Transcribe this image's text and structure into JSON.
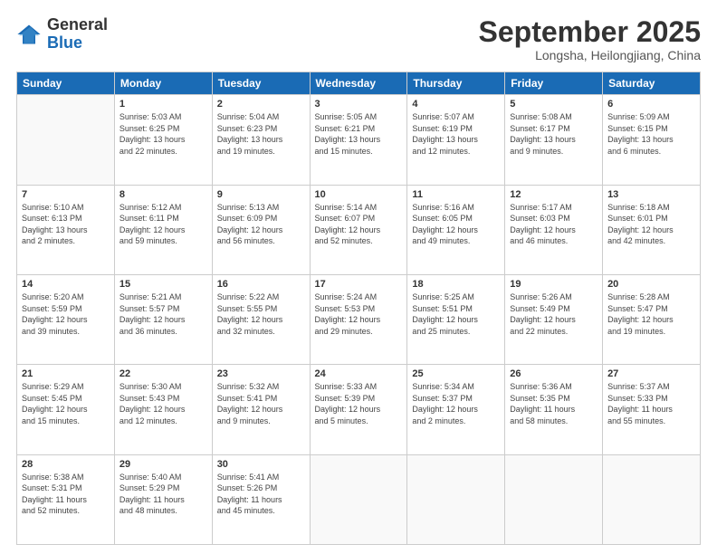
{
  "logo": {
    "general": "General",
    "blue": "Blue"
  },
  "title": "September 2025",
  "location": "Longsha, Heilongjiang, China",
  "days_of_week": [
    "Sunday",
    "Monday",
    "Tuesday",
    "Wednesday",
    "Thursday",
    "Friday",
    "Saturday"
  ],
  "weeks": [
    [
      {
        "day": "",
        "info": ""
      },
      {
        "day": "1",
        "info": "Sunrise: 5:03 AM\nSunset: 6:25 PM\nDaylight: 13 hours\nand 22 minutes."
      },
      {
        "day": "2",
        "info": "Sunrise: 5:04 AM\nSunset: 6:23 PM\nDaylight: 13 hours\nand 19 minutes."
      },
      {
        "day": "3",
        "info": "Sunrise: 5:05 AM\nSunset: 6:21 PM\nDaylight: 13 hours\nand 15 minutes."
      },
      {
        "day": "4",
        "info": "Sunrise: 5:07 AM\nSunset: 6:19 PM\nDaylight: 13 hours\nand 12 minutes."
      },
      {
        "day": "5",
        "info": "Sunrise: 5:08 AM\nSunset: 6:17 PM\nDaylight: 13 hours\nand 9 minutes."
      },
      {
        "day": "6",
        "info": "Sunrise: 5:09 AM\nSunset: 6:15 PM\nDaylight: 13 hours\nand 6 minutes."
      }
    ],
    [
      {
        "day": "7",
        "info": "Sunrise: 5:10 AM\nSunset: 6:13 PM\nDaylight: 13 hours\nand 2 minutes."
      },
      {
        "day": "8",
        "info": "Sunrise: 5:12 AM\nSunset: 6:11 PM\nDaylight: 12 hours\nand 59 minutes."
      },
      {
        "day": "9",
        "info": "Sunrise: 5:13 AM\nSunset: 6:09 PM\nDaylight: 12 hours\nand 56 minutes."
      },
      {
        "day": "10",
        "info": "Sunrise: 5:14 AM\nSunset: 6:07 PM\nDaylight: 12 hours\nand 52 minutes."
      },
      {
        "day": "11",
        "info": "Sunrise: 5:16 AM\nSunset: 6:05 PM\nDaylight: 12 hours\nand 49 minutes."
      },
      {
        "day": "12",
        "info": "Sunrise: 5:17 AM\nSunset: 6:03 PM\nDaylight: 12 hours\nand 46 minutes."
      },
      {
        "day": "13",
        "info": "Sunrise: 5:18 AM\nSunset: 6:01 PM\nDaylight: 12 hours\nand 42 minutes."
      }
    ],
    [
      {
        "day": "14",
        "info": "Sunrise: 5:20 AM\nSunset: 5:59 PM\nDaylight: 12 hours\nand 39 minutes."
      },
      {
        "day": "15",
        "info": "Sunrise: 5:21 AM\nSunset: 5:57 PM\nDaylight: 12 hours\nand 36 minutes."
      },
      {
        "day": "16",
        "info": "Sunrise: 5:22 AM\nSunset: 5:55 PM\nDaylight: 12 hours\nand 32 minutes."
      },
      {
        "day": "17",
        "info": "Sunrise: 5:24 AM\nSunset: 5:53 PM\nDaylight: 12 hours\nand 29 minutes."
      },
      {
        "day": "18",
        "info": "Sunrise: 5:25 AM\nSunset: 5:51 PM\nDaylight: 12 hours\nand 25 minutes."
      },
      {
        "day": "19",
        "info": "Sunrise: 5:26 AM\nSunset: 5:49 PM\nDaylight: 12 hours\nand 22 minutes."
      },
      {
        "day": "20",
        "info": "Sunrise: 5:28 AM\nSunset: 5:47 PM\nDaylight: 12 hours\nand 19 minutes."
      }
    ],
    [
      {
        "day": "21",
        "info": "Sunrise: 5:29 AM\nSunset: 5:45 PM\nDaylight: 12 hours\nand 15 minutes."
      },
      {
        "day": "22",
        "info": "Sunrise: 5:30 AM\nSunset: 5:43 PM\nDaylight: 12 hours\nand 12 minutes."
      },
      {
        "day": "23",
        "info": "Sunrise: 5:32 AM\nSunset: 5:41 PM\nDaylight: 12 hours\nand 9 minutes."
      },
      {
        "day": "24",
        "info": "Sunrise: 5:33 AM\nSunset: 5:39 PM\nDaylight: 12 hours\nand 5 minutes."
      },
      {
        "day": "25",
        "info": "Sunrise: 5:34 AM\nSunset: 5:37 PM\nDaylight: 12 hours\nand 2 minutes."
      },
      {
        "day": "26",
        "info": "Sunrise: 5:36 AM\nSunset: 5:35 PM\nDaylight: 11 hours\nand 58 minutes."
      },
      {
        "day": "27",
        "info": "Sunrise: 5:37 AM\nSunset: 5:33 PM\nDaylight: 11 hours\nand 55 minutes."
      }
    ],
    [
      {
        "day": "28",
        "info": "Sunrise: 5:38 AM\nSunset: 5:31 PM\nDaylight: 11 hours\nand 52 minutes."
      },
      {
        "day": "29",
        "info": "Sunrise: 5:40 AM\nSunset: 5:29 PM\nDaylight: 11 hours\nand 48 minutes."
      },
      {
        "day": "30",
        "info": "Sunrise: 5:41 AM\nSunset: 5:26 PM\nDaylight: 11 hours\nand 45 minutes."
      },
      {
        "day": "",
        "info": ""
      },
      {
        "day": "",
        "info": ""
      },
      {
        "day": "",
        "info": ""
      },
      {
        "day": "",
        "info": ""
      }
    ]
  ]
}
